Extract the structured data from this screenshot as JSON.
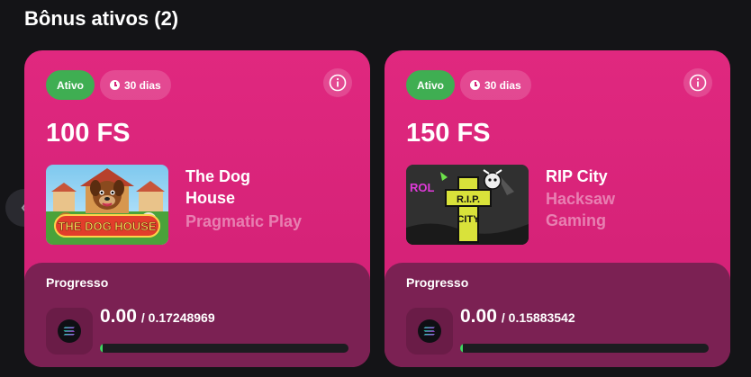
{
  "page": {
    "title": "Bônus ativos (2)"
  },
  "colors": {
    "card": "#d4237a",
    "active": "#3fae52",
    "progress_fill": "#3fd962"
  },
  "cards": [
    {
      "status": "Ativo",
      "duration": "30 dias",
      "amount": "100 FS",
      "game": "The Dog House",
      "provider": "Pragmatic Play",
      "thumbnail_text": "THE DOG HOUSE",
      "progress_label": "Progresso",
      "progress_current": "0.00",
      "progress_total": "/ 0.17248969",
      "progress_fraction": 0.01,
      "coin_icon": "solana-icon"
    },
    {
      "status": "Ativo",
      "duration": "30 dias",
      "amount": "150 FS",
      "game": "RIP City",
      "provider": "Hacksaw Gaming",
      "thumbnail_text_1": "R.I.P.",
      "thumbnail_text_2": "CITY",
      "thumbnail_text_3": "ROL",
      "progress_label": "Progresso",
      "progress_current": "0.00",
      "progress_total": "/ 0.15883542",
      "progress_fraction": 0.01,
      "coin_icon": "solana-icon"
    }
  ]
}
